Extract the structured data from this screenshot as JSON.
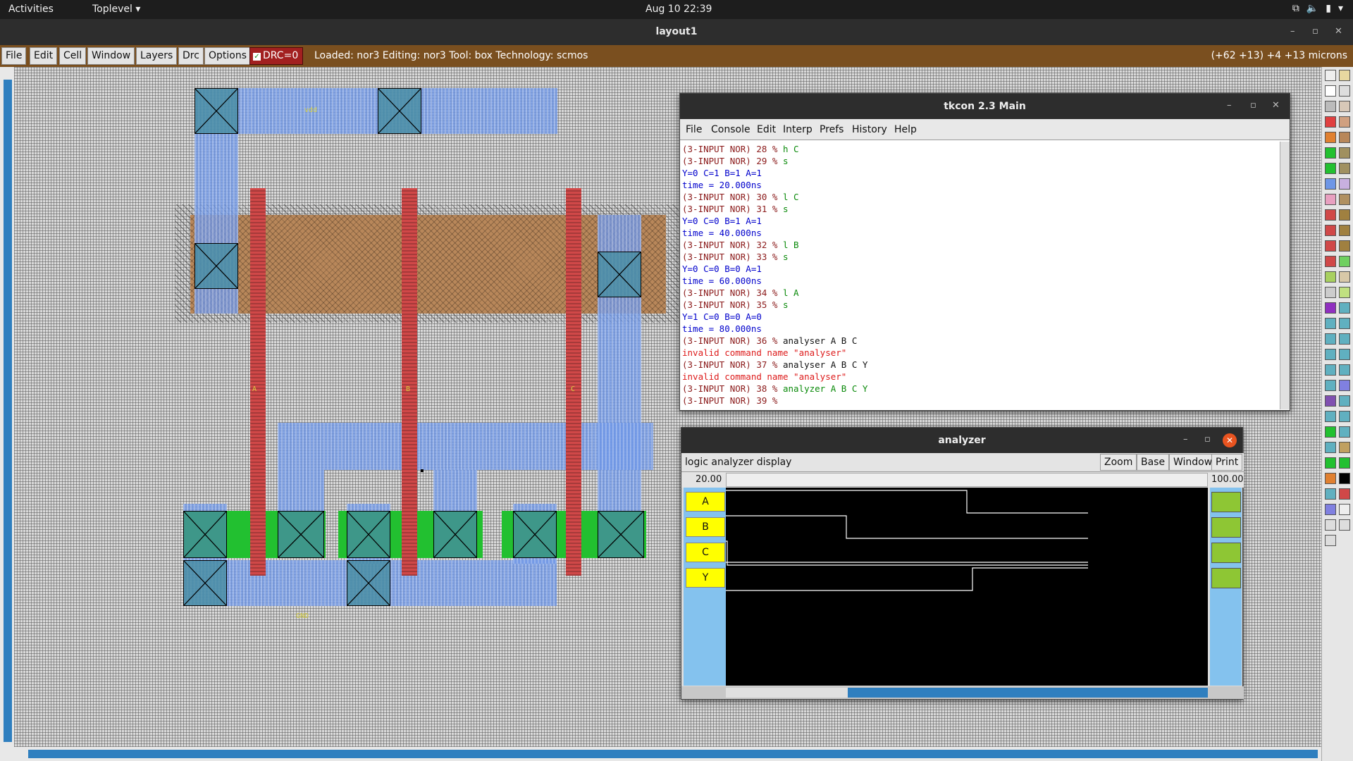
{
  "topbar": {
    "activities": "Activities",
    "app_menu": "Toplevel ▾",
    "clock": "Aug 10  22:39"
  },
  "window": {
    "title": "layout1"
  },
  "menubar": {
    "items": [
      "File",
      "Edit",
      "Cell",
      "Window",
      "Layers",
      "Drc",
      "Options"
    ],
    "drc_label": "DRC=0",
    "status": "Loaded: nor3 Editing: nor3 Tool: box  Technology: scmos",
    "coords": "(+62 +13) +4 +13 microns"
  },
  "layout_labels": {
    "vdd": "vdd",
    "a": "A",
    "b": "B",
    "c": "C",
    "gnd": "GND"
  },
  "tkcon": {
    "title": "tkcon 2.3 Main",
    "menu": [
      "File",
      "Console",
      "Edit",
      "Interp",
      "Prefs",
      "History",
      "Help"
    ],
    "lines": [
      {
        "prompt": "(3-INPUT NOR) 28 % ",
        "cmd": "h C",
        "type": "cmd"
      },
      {
        "prompt": "(3-INPUT NOR) 29 % ",
        "cmd": "s",
        "type": "cmd"
      },
      {
        "text": "Y=0 C=1 B=1 A=1",
        "type": "out"
      },
      {
        "text": "time = 20.000ns",
        "type": "out"
      },
      {
        "prompt": "(3-INPUT NOR) 30 % ",
        "cmd": "l C",
        "type": "cmd"
      },
      {
        "prompt": "(3-INPUT NOR) 31 % ",
        "cmd": "s",
        "type": "cmd"
      },
      {
        "text": "Y=0 C=0 B=1 A=1",
        "type": "out"
      },
      {
        "text": "time = 40.000ns",
        "type": "out"
      },
      {
        "prompt": "(3-INPUT NOR) 32 % ",
        "cmd": "l B",
        "type": "cmd"
      },
      {
        "prompt": "(3-INPUT NOR) 33 % ",
        "cmd": "s",
        "type": "cmd"
      },
      {
        "text": "Y=0 C=0 B=0 A=1",
        "type": "out"
      },
      {
        "text": "time = 60.000ns",
        "type": "out"
      },
      {
        "prompt": "(3-INPUT NOR) 34 % ",
        "cmd": "l A",
        "type": "cmd"
      },
      {
        "prompt": "(3-INPUT NOR) 35 % ",
        "cmd": "s",
        "type": "cmd"
      },
      {
        "text": "Y=1 C=0 B=0 A=0",
        "type": "out"
      },
      {
        "text": "time = 80.000ns",
        "type": "out"
      },
      {
        "prompt": "(3-INPUT NOR) 36 % ",
        "cmd": "analyser A B C",
        "type": "usr"
      },
      {
        "text": "invalid command name \"analyser\"",
        "type": "err"
      },
      {
        "prompt": "(3-INPUT NOR) 37 % ",
        "cmd": "analyser A B C Y",
        "type": "usr"
      },
      {
        "text": "invalid command name \"analyser\"",
        "type": "err"
      },
      {
        "prompt": "(3-INPUT NOR) 38 % ",
        "cmd": "analyzer A B C Y",
        "type": "cmd"
      },
      {
        "prompt": "(3-INPUT NOR) 39 % ",
        "cmd": "",
        "type": "cmd"
      }
    ]
  },
  "analyzer": {
    "title": "analyzer",
    "description": "logic analyzer display",
    "buttons": [
      "Zoom",
      "Base",
      "Window",
      "Print"
    ],
    "time_start": "20.00",
    "time_end": "100.00",
    "signals": [
      "A",
      "B",
      "C",
      "Y"
    ]
  },
  "colors": {
    "metal": "#6e96e6",
    "poly": "#d04848",
    "diffusion": "#22c030",
    "well": "#b8875a",
    "menubar": "#7a4f1f",
    "drc": "#a22020"
  }
}
